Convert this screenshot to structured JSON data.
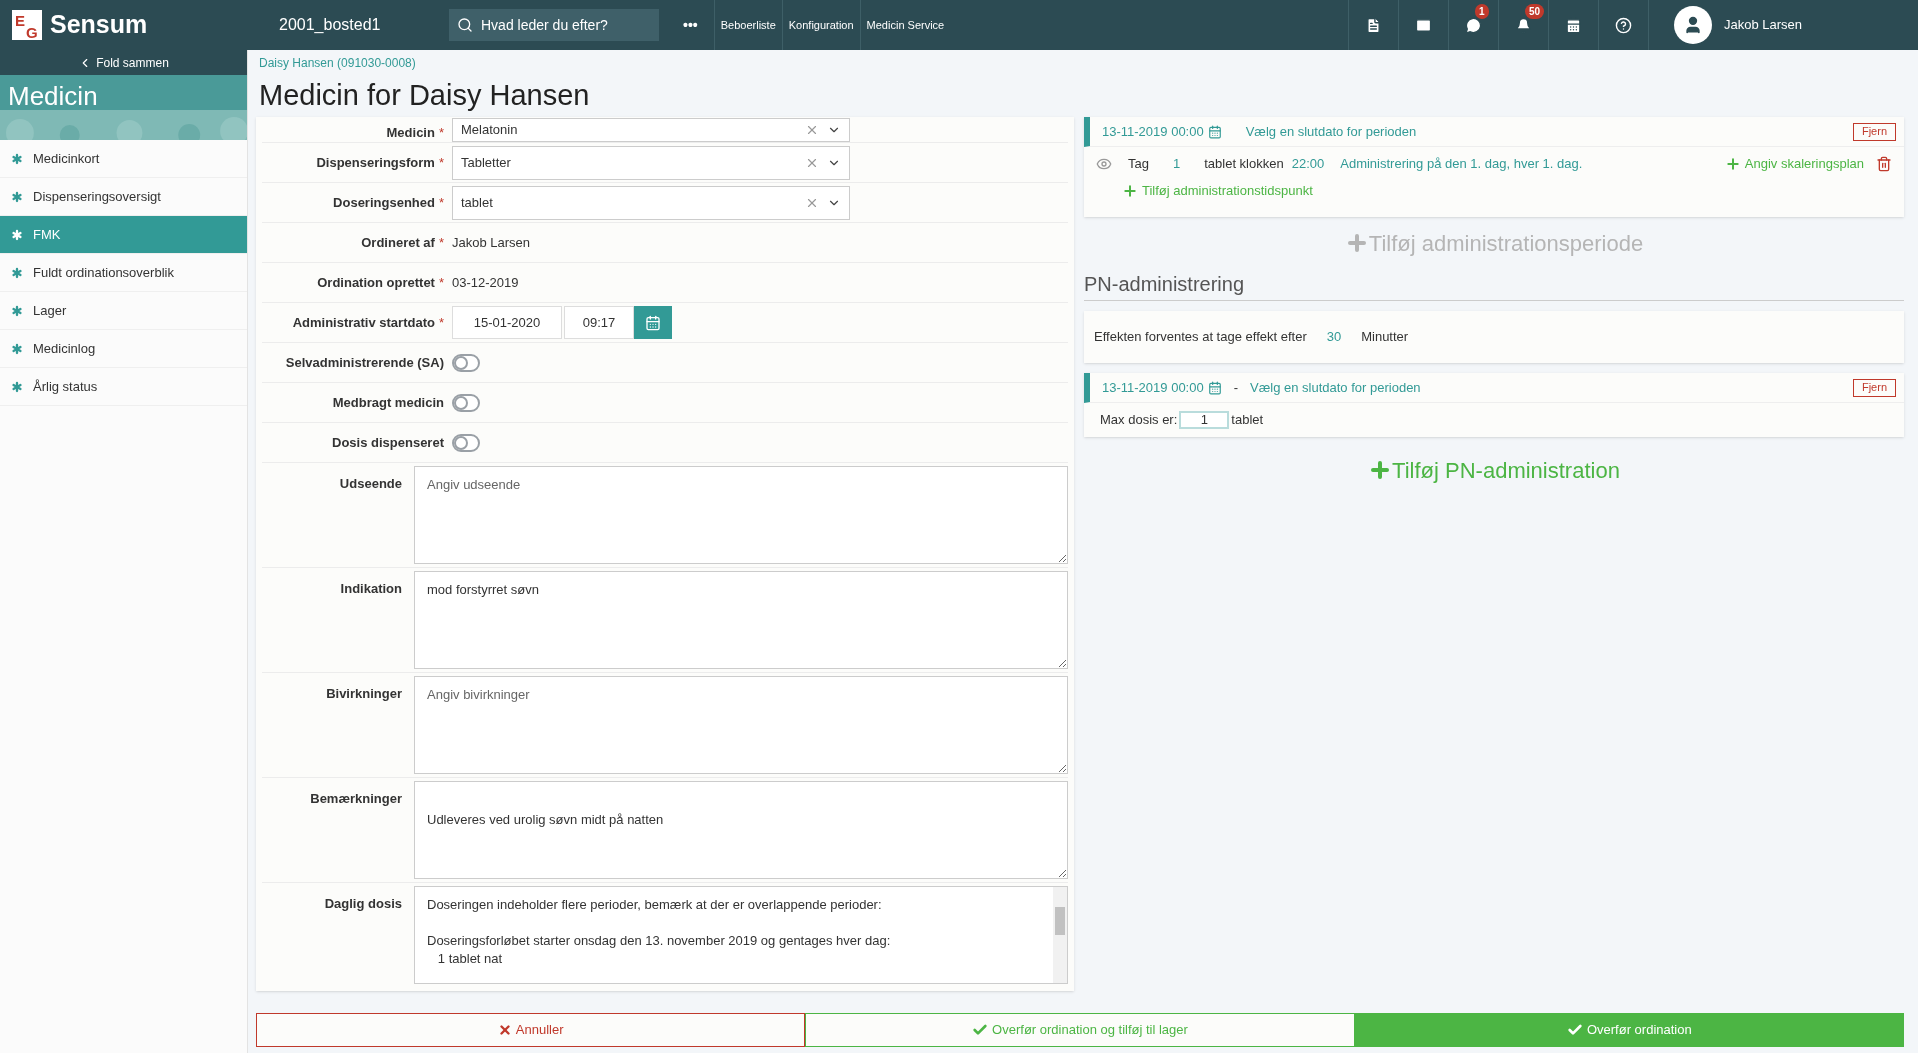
{
  "topbar": {
    "logo_mark": [
      "E",
      "G"
    ],
    "logo_text": "Sensum",
    "site": "2001_bosted1",
    "search": {
      "placeholder": "Hvad leder du efter?"
    },
    "more": "•••",
    "links": [
      "Beboerliste",
      "Konfiguration",
      "Medicin Service"
    ],
    "icons": [
      {
        "kind": "document"
      },
      {
        "kind": "mail"
      },
      {
        "kind": "chat",
        "badge": "1"
      },
      {
        "kind": "bell",
        "badge": "50"
      },
      {
        "kind": "calendar"
      },
      {
        "kind": "help"
      }
    ],
    "user": "Jakob Larsen"
  },
  "sidebar": {
    "collapse": "Fold sammen",
    "title": "Medicin",
    "items": [
      {
        "label": "Medicinkort",
        "selected": false
      },
      {
        "label": "Dispenseringsoversigt",
        "selected": false
      },
      {
        "label": "FMK",
        "selected": true
      },
      {
        "label": "Fuldt ordinationsoverblik",
        "selected": false
      },
      {
        "label": "Lager",
        "selected": false
      },
      {
        "label": "Medicinlog",
        "selected": false
      },
      {
        "label": "Årlig status",
        "selected": false
      }
    ]
  },
  "breadcrumb": "Daisy Hansen (091030-0008)",
  "title": "Medicin for Daisy Hansen",
  "form": [
    {
      "kind": "select",
      "label": "Medicin",
      "mark": "*",
      "value": "Melatonin"
    },
    {
      "kind": "select",
      "label": "Dispenseringsform",
      "mark": "*",
      "value": "Tabletter"
    },
    {
      "kind": "select",
      "label": "Doseringsenhed",
      "mark": "*",
      "value": "tablet"
    },
    {
      "kind": "text",
      "label": "Ordineret af",
      "mark": "*",
      "value": "Jakob Larsen"
    },
    {
      "kind": "text",
      "label": "Ordination oprettet",
      "mark": "*",
      "value": "03-12-2019"
    },
    {
      "kind": "datetime",
      "label": "Administrativ startdato",
      "mark": "*",
      "date": "15-01-2020",
      "time": "09:17"
    },
    {
      "kind": "toggle",
      "label": "Selvadministrerende (SA)",
      "on": false
    },
    {
      "kind": "toggle",
      "label": "Medbragt medicin",
      "on": false
    },
    {
      "kind": "toggle",
      "label": "Dosis dispenseret",
      "on": false
    },
    {
      "kind": "textarea",
      "label": "Udseende",
      "placeholder": "Angiv udseende"
    },
    {
      "kind": "textarea",
      "label": "Indikation",
      "value": "mod forstyrret søvn"
    },
    {
      "kind": "textarea",
      "label": "Bivirkninger",
      "placeholder": "Angiv bivirkninger"
    },
    {
      "kind": "textarea",
      "label": "Bemærkninger",
      "value": "\nUdleveres ved urolig søvn midt på natten"
    },
    {
      "kind": "scrollarea",
      "label": "Daglig dosis",
      "paragraphs": [
        [
          "Doseringen indeholder flere perioder, bemærk at der er overlappende perioder:"
        ],
        [
          "Doseringsforløbet starter onsdag den 13. november 2019 og gentages hver dag:",
          "   1 tablet nat"
        ]
      ]
    }
  ],
  "schedule": {
    "period": {
      "start": "13-11-2019 00:00",
      "end": "Vælg en slutdato for perioden",
      "remove": "Fjern"
    },
    "dose_row": {
      "word": "Tag",
      "amount": "1",
      "unit": "tablet klokken",
      "time": "22:00",
      "rule": "Administrering på den 1. dag, hver 1. dag.",
      "scale": "Angiv skaleringsplan"
    },
    "add_time": "Tilføj administrationstidspunkt",
    "add_period": "Tilføj administrationsperiode"
  },
  "pn": {
    "heading": "PN-administrering",
    "effect_label": "Effekten forventes at tage effekt efter",
    "effect_value": "30",
    "effect_unit": "Minutter",
    "period": {
      "start": "13-11-2019 00:00",
      "dash": "-",
      "end": "Vælg en slutdato for perioden",
      "remove": "Fjern"
    },
    "max_label": "Max dosis er:",
    "max_value": "1",
    "max_unit": "tablet",
    "add": "Tilføj PN-administration"
  },
  "actions": [
    {
      "kind": "cancel",
      "label": "Annuller"
    },
    {
      "kind": "secondary",
      "label": "Overfør ordination og tilføj til lager"
    },
    {
      "kind": "primary",
      "label": "Overfør ordination"
    }
  ]
}
